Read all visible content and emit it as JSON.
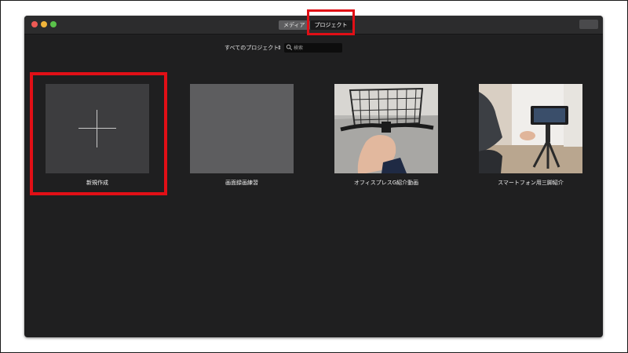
{
  "toolbar": {
    "tabs": [
      {
        "label": "メディア",
        "selected": false
      },
      {
        "label": "プロジェクト",
        "selected": true
      }
    ]
  },
  "filter": {
    "label": "すべてのプロジェクト",
    "chevron": "⌃⌄",
    "search_placeholder": "検索"
  },
  "projects": [
    {
      "label": "新規作成",
      "icon": "plus-icon"
    },
    {
      "label": "画面録画練習",
      "thumbnail": "gray-blank"
    },
    {
      "label": "オフィスプレスG紹介動画",
      "thumbnail": "bicycle-handlebar-photo"
    },
    {
      "label": "スマートフォン用三脚紹介",
      "thumbnail": "smartphone-tripod-photo"
    }
  ],
  "colors": {
    "window_bg": "#1f1f20",
    "highlight_red": "#e10f16",
    "accent_text": "#f0f0f0"
  }
}
